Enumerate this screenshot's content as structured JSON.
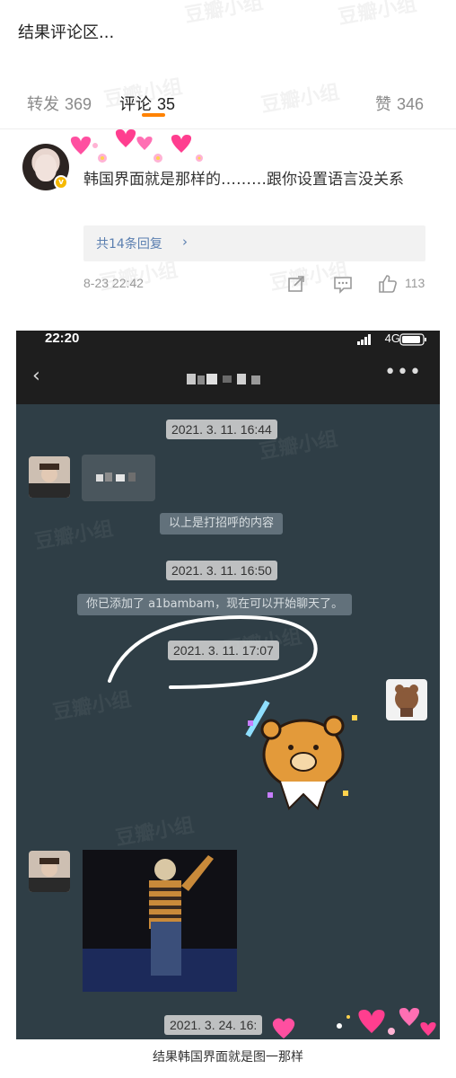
{
  "post": {
    "title": "结果评论区..."
  },
  "tabs": {
    "repost_label": "转发",
    "repost_count": "369",
    "comment_label": "评论",
    "comment_count": "35",
    "like_label": "赞",
    "like_count": "346"
  },
  "comment": {
    "text": "韩国界面就是那样的………跟你设置语言没关系",
    "replies_label": "共14条回复",
    "time": "8-23 22:42",
    "like_count": "113"
  },
  "watermark_text": "豆瓣小组",
  "screenshot": {
    "status_time": "22:20",
    "network": "4G",
    "timestamps": [
      "2021. 3. 11. 16:44",
      "2021. 3. 11. 16:50",
      "2021. 3. 11. 17:07",
      "2021. 3. 24. 16:"
    ],
    "system_msg_1": "以上是打招呼的内容",
    "system_msg_2": "你已添加了 a1bambam，现在可以开始聊天了。"
  },
  "caption": "结果韩国界面就是图一那样",
  "colors": {
    "accent": "#ff8200",
    "link": "#5b7fb0",
    "chat_bg": "#2f3e46"
  }
}
